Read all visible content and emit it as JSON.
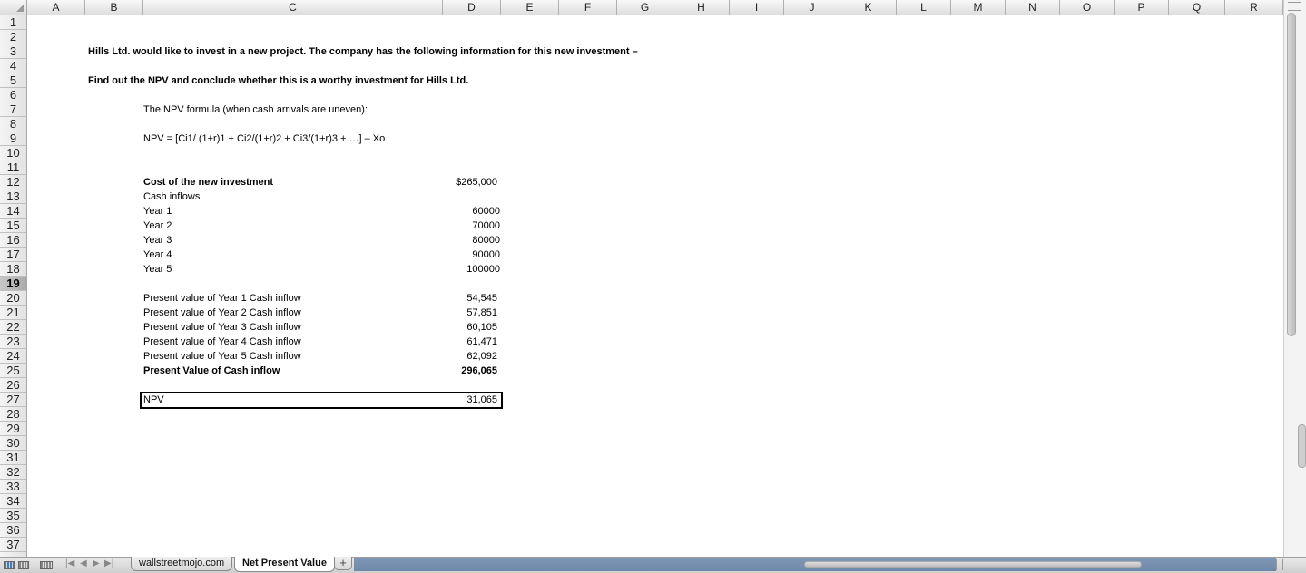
{
  "columns": [
    "A",
    "B",
    "C",
    "D",
    "E",
    "F",
    "G",
    "H",
    "I",
    "J",
    "K",
    "L",
    "M",
    "N",
    "O",
    "P",
    "Q",
    "R"
  ],
  "rows": [
    "1",
    "2",
    "3",
    "4",
    "5",
    "6",
    "7",
    "8",
    "9",
    "10",
    "11",
    "12",
    "13",
    "14",
    "15",
    "16",
    "17",
    "18",
    "19",
    "20",
    "21",
    "22",
    "23",
    "24",
    "25",
    "26",
    "27",
    "28",
    "29",
    "30",
    "31",
    "32",
    "33",
    "34",
    "35",
    "36",
    "37"
  ],
  "selected_row": "19",
  "cells": {
    "intro": "Hills Ltd. would like to invest in a new project. The company has the following information for this new investment –",
    "question": "Find out the NPV and conclude whether this is a worthy investment for Hills Ltd.",
    "formula_label": "The NPV formula (when cash arrivals are uneven):",
    "formula": "NPV = [Ci1/ (1+r)1 + Ci2/(1+r)2 + Ci3/(1+r)3 + …] – Xo",
    "cost_label": "Cost of the new investment",
    "cost_value": "$265,000",
    "cash_inflows_label": "Cash inflows",
    "years": [
      {
        "label": "Year 1",
        "value": "60000"
      },
      {
        "label": "Year 2",
        "value": "70000"
      },
      {
        "label": "Year 3",
        "value": "80000"
      },
      {
        "label": "Year 4",
        "value": "90000"
      },
      {
        "label": "Year 5",
        "value": "100000"
      }
    ],
    "present_values": [
      {
        "label": "Present value of Year 1 Cash inflow",
        "value": "54,545"
      },
      {
        "label": "Present value of Year 2 Cash inflow",
        "value": "57,851"
      },
      {
        "label": "Present value of Year 3 Cash inflow",
        "value": "60,105"
      },
      {
        "label": "Present value of Year 4 Cash inflow",
        "value": "61,471"
      },
      {
        "label": "Present value of Year 5 Cash inflow",
        "value": "62,092"
      }
    ],
    "pv_total_label": "Present Value of Cash inflow",
    "pv_total_value": "296,065",
    "npv_label": "NPV",
    "npv_value": "31,065"
  },
  "sheet_tabs": [
    "wallstreetmojo.com",
    "Net Present Value"
  ],
  "active_tab": "Net Present Value",
  "add_tab_label": "+",
  "nav_arrows": {
    "first": "|◀",
    "prev": "◀",
    "next": "▶",
    "last": "▶|"
  },
  "icons": {
    "normal_view": "normal-view-icon",
    "page_layout": "page-layout-view-icon"
  }
}
